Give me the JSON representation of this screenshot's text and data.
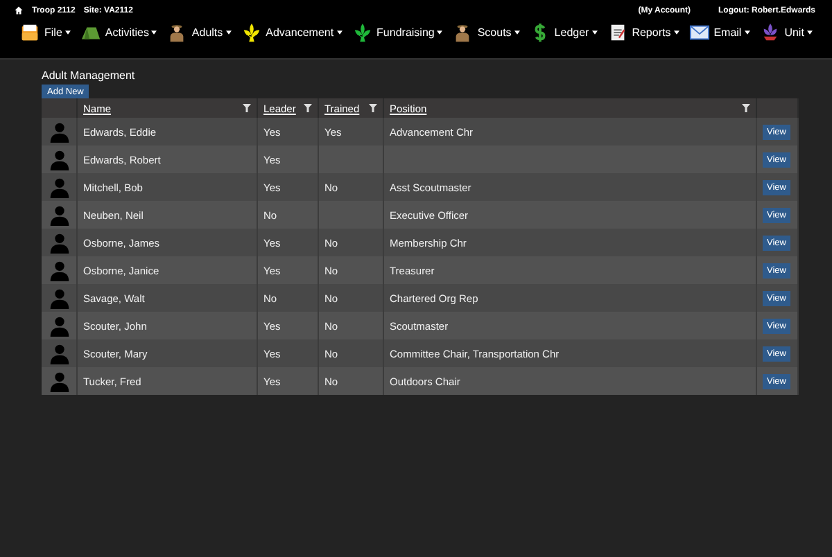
{
  "top_bar": {
    "troop": "Troop 2112",
    "site": "Site: VA2112",
    "account_link": "(My Account)",
    "logout": "Logout: Robert.Edwards"
  },
  "menu": [
    {
      "label": "File"
    },
    {
      "label": "Activities"
    },
    {
      "label": "Adults"
    },
    {
      "label": "Advancement"
    },
    {
      "label": "Fundraising"
    },
    {
      "label": "Scouts"
    },
    {
      "label": "Ledger"
    },
    {
      "label": "Reports"
    },
    {
      "label": "Email"
    },
    {
      "label": "Unit"
    }
  ],
  "page_title": "Adult Management",
  "add_button": "Add New",
  "table": {
    "columns": [
      "Name",
      "Leader",
      "Trained",
      "Position"
    ],
    "rows": [
      {
        "name": "Edwards, Eddie",
        "leader": "Yes",
        "trained": "Yes",
        "position": "Advancement Chr",
        "action": "View"
      },
      {
        "name": "Edwards, Robert",
        "leader": "Yes",
        "trained": "",
        "position": "",
        "action": "View"
      },
      {
        "name": "Mitchell, Bob",
        "leader": "Yes",
        "trained": "No",
        "position": "Asst Scoutmaster",
        "action": "View"
      },
      {
        "name": "Neuben, Neil",
        "leader": "No",
        "trained": "",
        "position": "Executive Officer",
        "action": "View"
      },
      {
        "name": "Osborne, James",
        "leader": "Yes",
        "trained": "No",
        "position": "Membership Chr",
        "action": "View"
      },
      {
        "name": "Osborne, Janice",
        "leader": "Yes",
        "trained": "No",
        "position": "Treasurer",
        "action": "View"
      },
      {
        "name": "Savage, Walt",
        "leader": "No",
        "trained": "No",
        "position": "Chartered Org Rep",
        "action": "View"
      },
      {
        "name": "Scouter, John",
        "leader": "Yes",
        "trained": "No",
        "position": "Scoutmaster",
        "action": "View"
      },
      {
        "name": "Scouter, Mary",
        "leader": "Yes",
        "trained": "No",
        "position": "Committee Chair, Transportation Chr",
        "action": "View"
      },
      {
        "name": "Tucker, Fred",
        "leader": "Yes",
        "trained": "No",
        "position": "Outdoors Chair",
        "action": "View"
      }
    ]
  }
}
